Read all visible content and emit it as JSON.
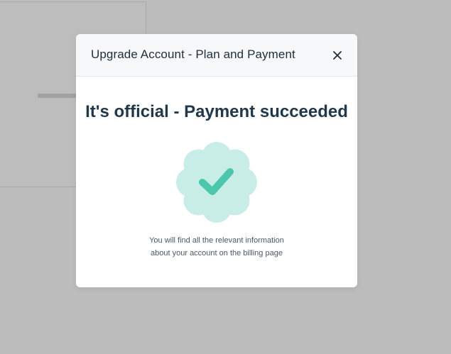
{
  "modal": {
    "title": "Upgrade Account - Plan and Payment",
    "close_icon": "close-icon",
    "headline": "It's official - Payment succeeded",
    "badge_icon": "checkmark-badge-icon",
    "message_line1": "You will find all the relevant information",
    "message_line2": "about your account on the billing page"
  },
  "colors": {
    "overlay": "#bcbcbc",
    "headline": "#21384a",
    "badge_fill": "#c7ede6",
    "check": "#4cc6ad"
  }
}
